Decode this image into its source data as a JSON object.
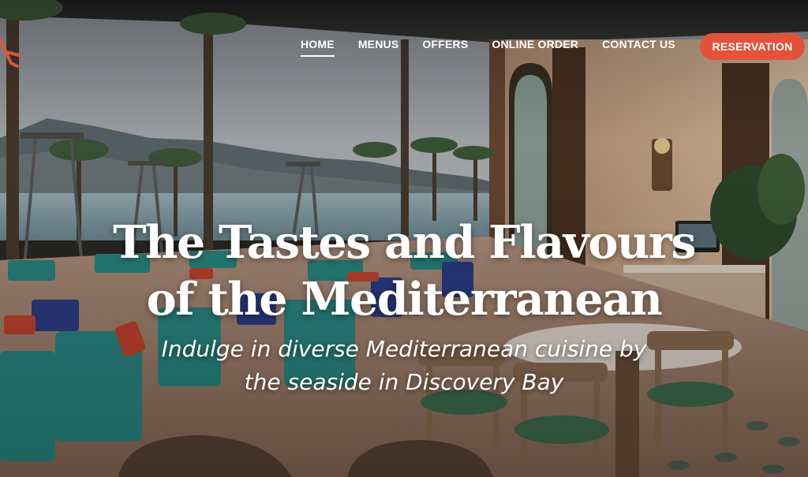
{
  "nav": {
    "items": [
      {
        "label": "HOME",
        "active": true
      },
      {
        "label": "MENUS",
        "active": false
      },
      {
        "label": "OFFERS",
        "active": false
      },
      {
        "label": "ONLINE ORDER",
        "active": false
      },
      {
        "label": "CONTACT US",
        "active": false
      }
    ],
    "reservation_label": "RESERVATION"
  },
  "hero": {
    "title_lines": [
      "The Tastes and Flavours",
      "of the Mediterranean"
    ],
    "subtitle_lines": [
      "Indulge in diverse Mediterranean cuisine by",
      "the seaside in Discovery Bay"
    ]
  },
  "colors": {
    "accent": "#e2533a",
    "text": "#ffffff"
  },
  "icons": {
    "logo": "brand-logo-icon"
  }
}
